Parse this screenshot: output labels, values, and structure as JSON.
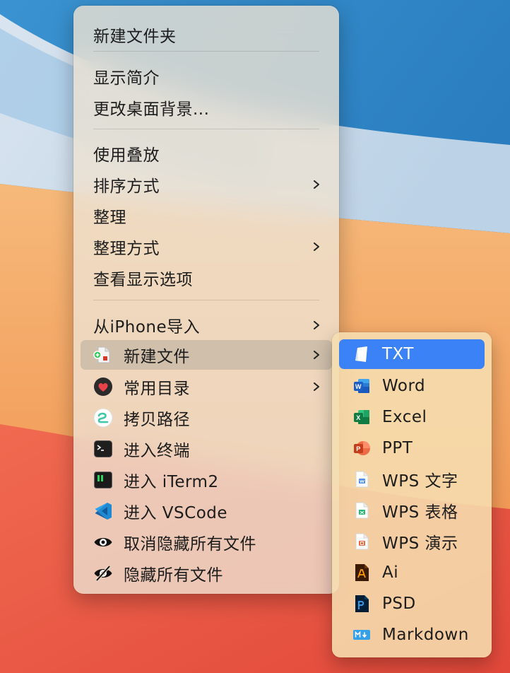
{
  "colors": {
    "selection": "#3b82f6",
    "menu_background": "#eee2d2",
    "submenu_background": "#f6deb0",
    "text": "#1c1c1c"
  },
  "context_menu": {
    "items": [
      {
        "label": "新建文件夹"
      },
      {
        "label": "显示简介"
      },
      {
        "label": "更改桌面背景..."
      },
      {
        "label": "使用叠放"
      },
      {
        "label": "排序方式"
      },
      {
        "label": "整理"
      },
      {
        "label": "整理方式"
      },
      {
        "label": "查看显示选项"
      },
      {
        "label": "从iPhone导入"
      },
      {
        "label": "新建文件",
        "icon": "new-file-icon"
      },
      {
        "label": "常用目录",
        "icon": "heart-icon"
      },
      {
        "label": "拷贝路径",
        "icon": "copy-path-icon"
      },
      {
        "label": "进入终端",
        "icon": "terminal-icon"
      },
      {
        "label": "进入 iTerm2",
        "icon": "iterm2-icon"
      },
      {
        "label": "进入 VSCode",
        "icon": "vscode-icon"
      },
      {
        "label": "取消隐藏所有文件",
        "icon": "eye-icon"
      },
      {
        "label": "隐藏所有文件",
        "icon": "eye-slash-icon"
      }
    ]
  },
  "new_file_submenu": {
    "items": [
      {
        "label": "TXT",
        "icon": "txt-file-icon"
      },
      {
        "label": "Word",
        "icon": "word-icon"
      },
      {
        "label": "Excel",
        "icon": "excel-icon"
      },
      {
        "label": "PPT",
        "icon": "powerpoint-icon"
      },
      {
        "label": "WPS 文字",
        "icon": "wps-writer-icon"
      },
      {
        "label": "WPS 表格",
        "icon": "wps-spreadsheet-icon"
      },
      {
        "label": "WPS 演示",
        "icon": "wps-presentation-icon"
      },
      {
        "label": "Ai",
        "icon": "illustrator-icon"
      },
      {
        "label": "PSD",
        "icon": "photoshop-icon"
      },
      {
        "label": "Markdown",
        "icon": "markdown-icon"
      }
    ]
  }
}
